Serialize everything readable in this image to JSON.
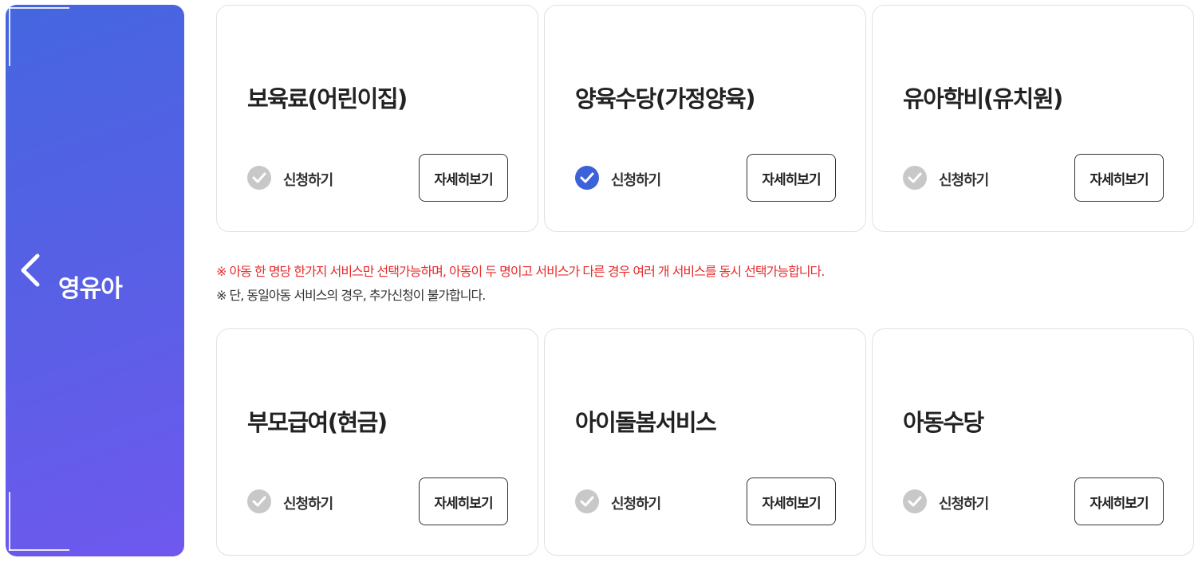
{
  "sidebar": {
    "label": "영유아",
    "back_icon": "chevron-left-icon"
  },
  "notices": {
    "primary": "※ 아동 한 명당 한가지 서비스만 선택가능하며, 아동이 두 명이고 서비스가 다른 경우 여러 개 서비스를 동시 선택가능합니다.",
    "secondary": "※ 단, 동일아동 서비스의 경우, 추가신청이 불가합니다."
  },
  "colors": {
    "accent": "#3b62d8",
    "notice_red": "#e62b2b",
    "panel_gradient_start": "#4566e0",
    "panel_gradient_end": "#6f58ee"
  },
  "services": [
    {
      "title": "보육료(어린이집)",
      "apply_label": "신청하기",
      "detail_label": "자세히보기",
      "checked": false
    },
    {
      "title": "양육수당(가정양육)",
      "apply_label": "신청하기",
      "detail_label": "자세히보기",
      "checked": true
    },
    {
      "title": "유아학비(유치원)",
      "apply_label": "신청하기",
      "detail_label": "자세히보기",
      "checked": false
    },
    {
      "title": "부모급여(현금)",
      "apply_label": "신청하기",
      "detail_label": "자세히보기",
      "checked": false
    },
    {
      "title": "아이돌봄서비스",
      "apply_label": "신청하기",
      "detail_label": "자세히보기",
      "checked": false
    },
    {
      "title": "아동수당",
      "apply_label": "신청하기",
      "detail_label": "자세히보기",
      "checked": false
    }
  ]
}
